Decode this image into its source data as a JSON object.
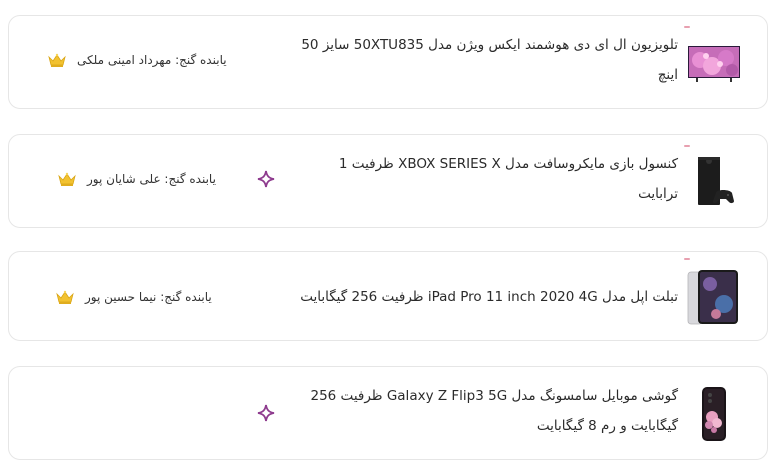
{
  "colors": {
    "accent": "#8e3b8e",
    "crown_gold": "#f2c230",
    "border": "#e6e6e6"
  },
  "prizes": [
    {
      "title_line1": "تلویزیون ال ای دی هوشمند ایکس ویژن مدل 50XTU835 سایز 50",
      "title_line2": "اینچ",
      "winner": "یابنده گنج: مهرداد امینی ملکی",
      "badge": "crown-icon",
      "image": "tv-icon"
    },
    {
      "title_line1": "کنسول بازی مایکروسافت مدل XBOX SERIES X ظرفیت 1",
      "title_line2": "ترابایت",
      "winner": "یابنده گنج: علی شایان پور",
      "badge": "crown-icon",
      "image": "xbox-icon",
      "action": "sparkle-icon"
    },
    {
      "title_line1": "تبلت اپل مدل iPad Pro 11 inch 2020 4G ظرفیت 256 گیگابایت",
      "title_line2": "",
      "winner": "یابنده گنج: نیما حسین پور",
      "badge": "crown-icon",
      "image": "tablet-icon"
    },
    {
      "title_line1": "گوشی موبایل سامسونگ مدل Galaxy Z Flip3 5G ظرفیت 256",
      "title_line2": "گیگابایت و رم 8 گیگابایت",
      "winner": "",
      "image": "phone-icon",
      "action": "sparkle-icon"
    }
  ]
}
